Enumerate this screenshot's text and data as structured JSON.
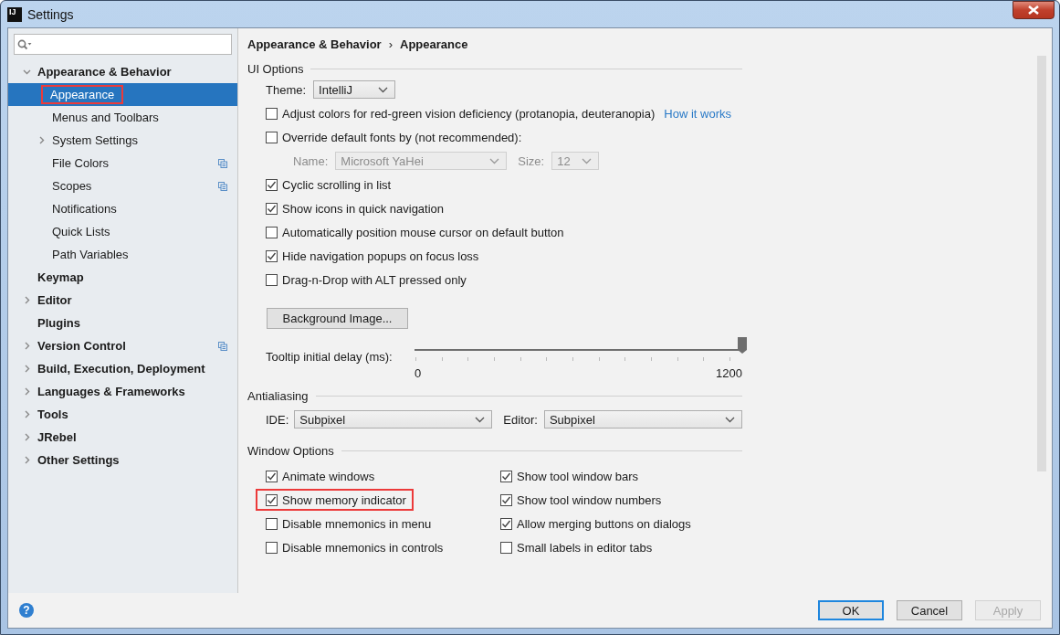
{
  "window": {
    "logo_text": "IJ",
    "title": "Settings"
  },
  "sidebar": {
    "items": [
      {
        "label": "Appearance & Behavior",
        "bold": true,
        "expanded": true,
        "selected": false,
        "highlighted": false,
        "project_icon": false,
        "children": [
          {
            "label": "Appearance",
            "bold": false,
            "selected": true,
            "highlighted": true,
            "project_icon": false
          },
          {
            "label": "Menus and Toolbars",
            "bold": false,
            "selected": false,
            "highlighted": false,
            "project_icon": false
          },
          {
            "label": "System Settings",
            "bold": false,
            "expanded": false,
            "selected": false,
            "highlighted": false,
            "project_icon": false
          },
          {
            "label": "File Colors",
            "bold": false,
            "selected": false,
            "highlighted": false,
            "project_icon": true
          },
          {
            "label": "Scopes",
            "bold": false,
            "selected": false,
            "highlighted": false,
            "project_icon": true
          },
          {
            "label": "Notifications",
            "bold": false,
            "selected": false,
            "highlighted": false,
            "project_icon": false
          },
          {
            "label": "Quick Lists",
            "bold": false,
            "selected": false,
            "highlighted": false,
            "project_icon": false
          },
          {
            "label": "Path Variables",
            "bold": false,
            "selected": false,
            "highlighted": false,
            "project_icon": false
          }
        ]
      },
      {
        "label": "Keymap",
        "bold": true,
        "selected": false,
        "highlighted": false,
        "project_icon": false
      },
      {
        "label": "Editor",
        "bold": true,
        "expanded": false,
        "selected": false,
        "highlighted": false,
        "project_icon": false
      },
      {
        "label": "Plugins",
        "bold": true,
        "selected": false,
        "highlighted": false,
        "project_icon": false
      },
      {
        "label": "Version Control",
        "bold": true,
        "expanded": false,
        "selected": false,
        "highlighted": false,
        "project_icon": true
      },
      {
        "label": "Build, Execution, Deployment",
        "bold": true,
        "expanded": false,
        "selected": false,
        "highlighted": false,
        "project_icon": false
      },
      {
        "label": "Languages & Frameworks",
        "bold": true,
        "expanded": false,
        "selected": false,
        "highlighted": false,
        "project_icon": false
      },
      {
        "label": "Tools",
        "bold": true,
        "expanded": false,
        "selected": false,
        "highlighted": false,
        "project_icon": false
      },
      {
        "label": "JRebel",
        "bold": true,
        "expanded": false,
        "selected": false,
        "highlighted": false,
        "project_icon": false
      },
      {
        "label": "Other Settings",
        "bold": true,
        "expanded": false,
        "selected": false,
        "highlighted": false,
        "project_icon": false
      }
    ]
  },
  "breadcrumb": {
    "parts": [
      "Appearance & Behavior",
      "Appearance"
    ],
    "separator": "›"
  },
  "ui_options": {
    "title": "UI Options",
    "theme": {
      "label": "Theme:",
      "value": "IntelliJ"
    },
    "items": [
      {
        "kind": "checkbox",
        "label": "Adjust colors for red-green vision deficiency (protanopia, deuteranopia)",
        "checked": false,
        "link": "How it works"
      },
      {
        "kind": "checkbox",
        "label": "Override default fonts by (not recommended):",
        "checked": false
      },
      {
        "kind": "font_row",
        "name_label": "Name:",
        "name_value": "Microsoft YaHei",
        "size_label": "Size:",
        "size_value": "12",
        "disabled": true
      },
      {
        "kind": "checkbox",
        "label": "Cyclic scrolling in list",
        "checked": true
      },
      {
        "kind": "checkbox",
        "label": "Show icons in quick navigation",
        "checked": true
      },
      {
        "kind": "checkbox",
        "label": "Automatically position mouse cursor on default button",
        "checked": false
      },
      {
        "kind": "checkbox",
        "label": "Hide navigation popups on focus loss",
        "checked": true
      },
      {
        "kind": "checkbox",
        "label": "Drag-n-Drop with ALT pressed only",
        "checked": false
      }
    ],
    "background_button": "Background Image...",
    "tooltip_delay": {
      "label": "Tooltip initial delay (ms):",
      "level": 1,
      "min_label": "0",
      "max_label": "1200"
    }
  },
  "antialiasing": {
    "title": "Antialiasing",
    "ide": {
      "label": "IDE:",
      "value": "Subpixel"
    },
    "editor": {
      "label": "Editor:",
      "value": "Subpixel"
    }
  },
  "window_options": {
    "title": "Window Options",
    "items": [
      {
        "label": "Animate windows",
        "checked": true,
        "highlighted": false
      },
      {
        "label": "Show tool window bars",
        "checked": true,
        "highlighted": false
      },
      {
        "label": "Show memory indicator",
        "checked": true,
        "highlighted": true
      },
      {
        "label": "Show tool window numbers",
        "checked": true,
        "highlighted": false
      },
      {
        "label": "Disable mnemonics in menu",
        "checked": false,
        "highlighted": false
      },
      {
        "label": "Allow merging buttons on dialogs",
        "checked": true,
        "highlighted": false
      },
      {
        "label": "Disable mnemonics in controls",
        "checked": false,
        "highlighted": false
      },
      {
        "label": "Small labels in editor tabs",
        "checked": false,
        "highlighted": false
      }
    ]
  },
  "footer": {
    "help": "?",
    "buttons": [
      {
        "label": "OK",
        "default": true,
        "disabled": false
      },
      {
        "label": "Cancel",
        "default": false,
        "disabled": false
      },
      {
        "label": "Apply",
        "default": false,
        "disabled": true
      }
    ]
  }
}
